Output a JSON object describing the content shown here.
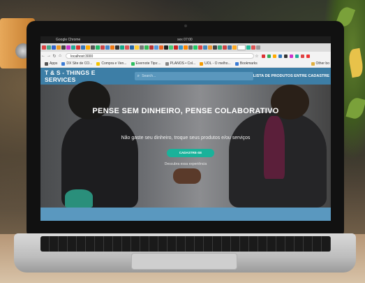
{
  "browser": {
    "app_name": "Google Chrome",
    "clock": "sex 07:00",
    "address": "localhost:3000",
    "bookmarks": [
      "Apps",
      "DX Site de CO...",
      "Compra e Ven...",
      "Evernote Tips:...",
      "PLANOS • Col...",
      "UOL - O melho...",
      "Bookmarks",
      "Other bo"
    ]
  },
  "site": {
    "brand": "T & S - THINGS E SERVICES",
    "search_placeholder": "Search...",
    "nav_link": "LISTA DE PRODUTOS ENTRE CADASTRE",
    "hero": {
      "title": "PENSE SEM DINHEIRO, PENSE COLABORATIVO",
      "subtitle": "Não gaste seu dinheiro, troque seus produtos e/ou serviços",
      "button": "CADASTRE-SE",
      "link": "Descubra essa experiência"
    }
  },
  "colors": {
    "navbar": "#3d7ea6",
    "accent_button": "#1ab29a"
  }
}
